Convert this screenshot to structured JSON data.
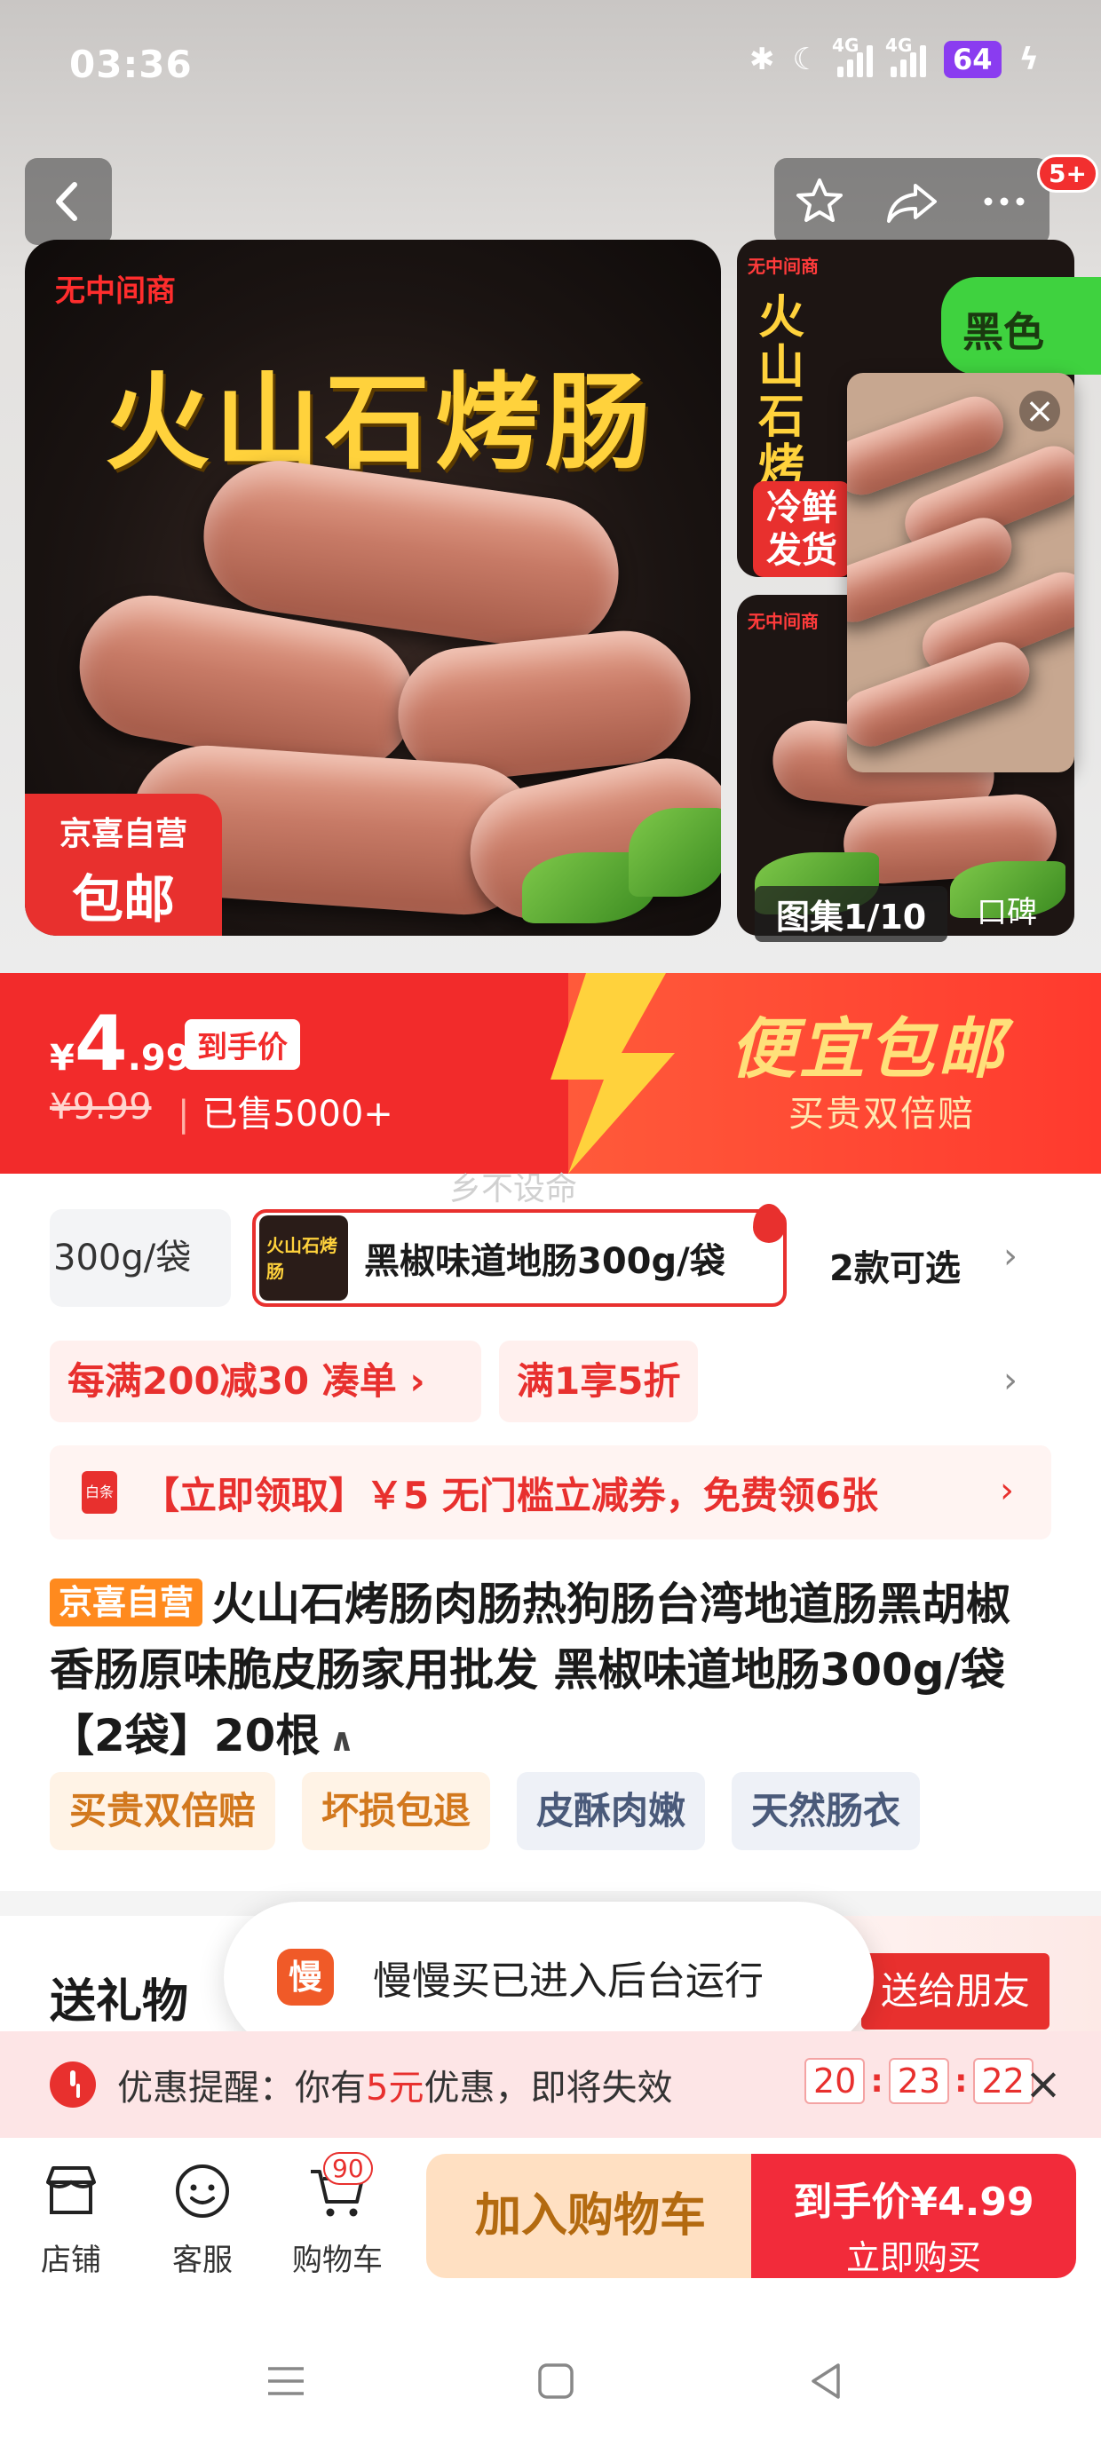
{
  "status_bar": {
    "time": "03:36",
    "battery": "64",
    "network": "4G"
  },
  "header": {
    "more_badge": "5+"
  },
  "gallery": {
    "main": {
      "top_tag": "无中间商",
      "title": "火山石烤肠",
      "badge_line1": "京喜自营",
      "badge_line2": "包邮"
    },
    "thumb1": {
      "small_tag": "无中间商",
      "title": "火山石烤肠",
      "stamp": "冷鲜发货"
    },
    "thumb2": {
      "small_tag": "无中间商"
    },
    "side_tag": "黑色",
    "counter": "图集1/10",
    "koubei": "口碑"
  },
  "price": {
    "currency": "¥",
    "integer": "4",
    "decimal": ".99",
    "tag": "到手价",
    "original": "¥9.99",
    "sold": "已售5000+",
    "promo_title": "便宜包邮",
    "promo_sub": "买贵双倍赔",
    "watermark": "乡不设命"
  },
  "variants": {
    "prev_label": "300g/袋",
    "selected_thumb_text": "火山石烤肠",
    "selected_label": "黑椒味道地肠300g/袋",
    "more": "2款可选"
  },
  "promotions": {
    "discount": "每满200减30",
    "bundle": "凑单",
    "first": "满1享5折"
  },
  "coupon": {
    "icon_text": "白条",
    "text": "【立即领取】￥5 无门槛立减券，免费领6张"
  },
  "product": {
    "self_badge": "京喜自营",
    "title": "火山石烤肠肉肠热狗肠台湾地道肠黑胡椒香肠原味脆皮肠家用批发 黑椒味道地肠300g/袋 【2袋】20根",
    "tags": [
      "买贵双倍赔",
      "坏损包退",
      "皮酥肉嫩",
      "天然肠衣"
    ]
  },
  "gift": {
    "title": "送礼物",
    "button": "送给朋友"
  },
  "toast": {
    "icon_text": "慢",
    "text": "慢慢买已进入后台运行"
  },
  "reminder": {
    "prefix": "优惠提醒：你有",
    "amount": "5元",
    "suffix": "优惠，即将失效",
    "hh": "20",
    "mm": "23",
    "ss": "22"
  },
  "bottom_bar": {
    "shop": "店铺",
    "service": "客服",
    "cart": "购物车",
    "cart_count": "90",
    "add_to_cart": "加入购物车",
    "buy_line1": "到手价¥4.99",
    "buy_line2": "立即购买"
  },
  "colors": {
    "brand_red": "#e8302e",
    "price_red": "#f22b2b",
    "gold": "#ffd23c",
    "cart_bg": "#ffe0c2"
  }
}
